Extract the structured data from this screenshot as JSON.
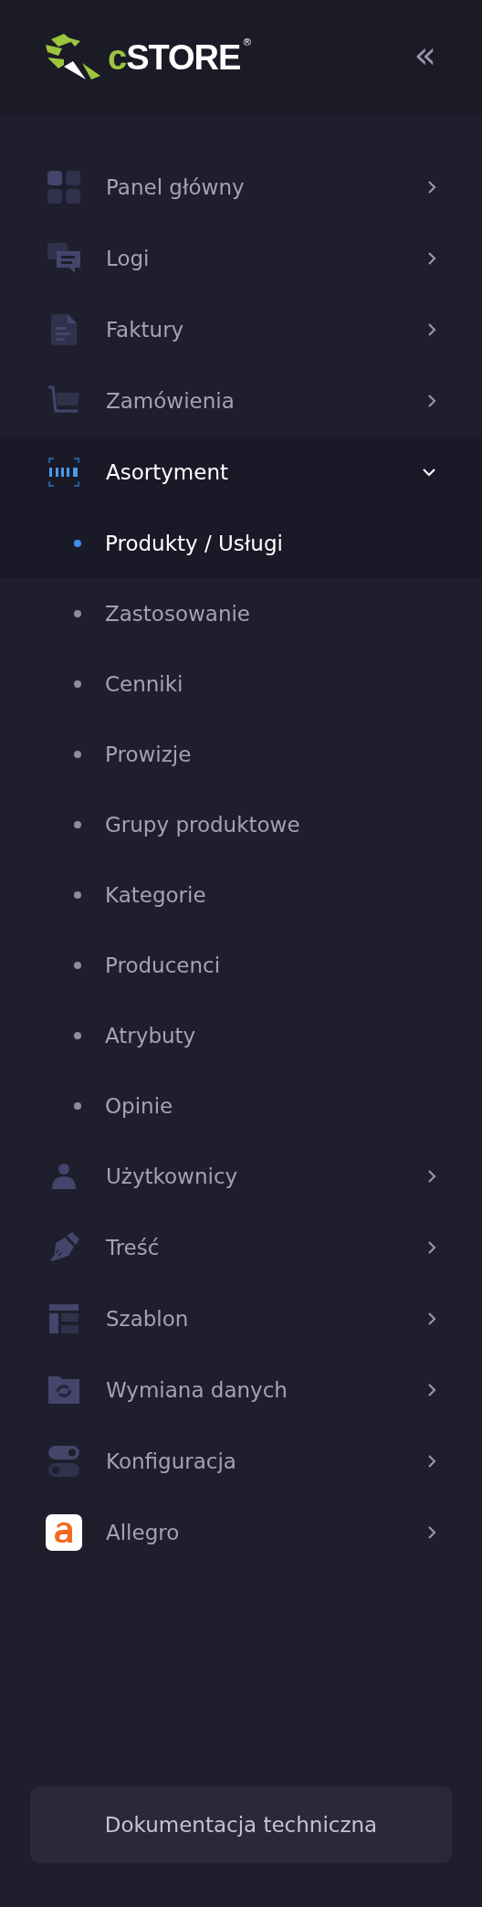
{
  "logo": {
    "prefix": "c",
    "name": "STORE",
    "mark": "®"
  },
  "collapse_button": {
    "label": "«"
  },
  "menu": [
    {
      "label": "Panel główny",
      "selected": false,
      "expanded": false
    },
    {
      "label": "Logi",
      "selected": false,
      "expanded": false
    },
    {
      "label": "Faktury",
      "selected": false,
      "expanded": false
    },
    {
      "label": "Zamówienia",
      "selected": false,
      "expanded": false
    },
    {
      "label": "Asortyment",
      "selected": true,
      "expanded": true,
      "children": [
        {
          "label": "Produkty / Usługi",
          "selected": true
        },
        {
          "label": "Zastosowanie",
          "selected": false
        },
        {
          "label": "Cenniki",
          "selected": false
        },
        {
          "label": "Prowizje",
          "selected": false
        },
        {
          "label": "Grupy produktowe",
          "selected": false
        },
        {
          "label": "Kategorie",
          "selected": false
        },
        {
          "label": "Producenci",
          "selected": false
        },
        {
          "label": "Atrybuty",
          "selected": false
        },
        {
          "label": "Opinie",
          "selected": false
        }
      ]
    },
    {
      "label": "Użytkownicy",
      "selected": false,
      "expanded": false
    },
    {
      "label": "Treść",
      "selected": false,
      "expanded": false
    },
    {
      "label": "Szablon",
      "selected": false,
      "expanded": false
    },
    {
      "label": "Wymiana danych",
      "selected": false,
      "expanded": false
    },
    {
      "label": "Konfiguracja",
      "selected": false,
      "expanded": false
    },
    {
      "label": "Allegro",
      "selected": false,
      "expanded": false
    }
  ],
  "footer_button": {
    "label": "Dokumentacja techniczna"
  }
}
